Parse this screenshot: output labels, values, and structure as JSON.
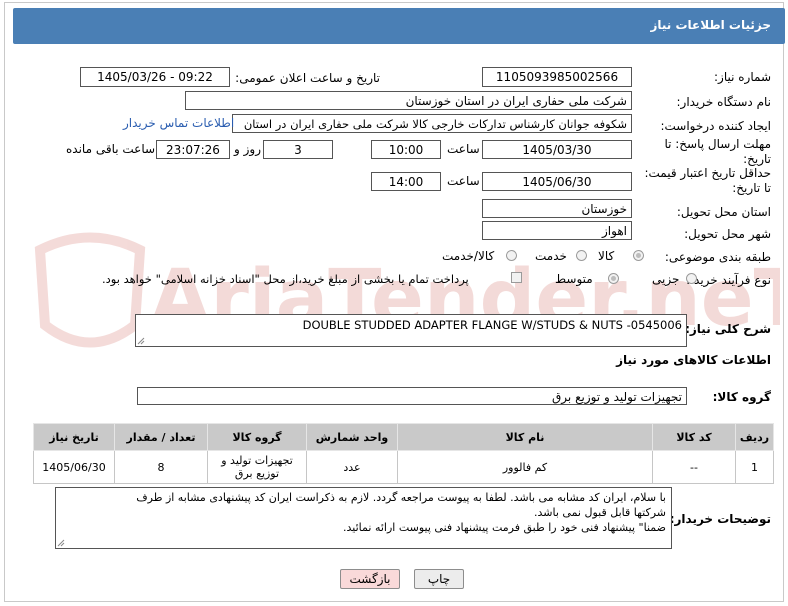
{
  "header": {
    "title": "جزئیات اطلاعات نیاز"
  },
  "fields": {
    "need_number_label": "شماره نیاز:",
    "need_number": "1105093985002566",
    "announce_label": "تاریخ و ساعت اعلان عمومی:",
    "announce_value": "1405/03/26 - 09:22",
    "buyer_org_label": "نام دستگاه خریدار:",
    "buyer_org": "شرکت ملی حفاری ایران در استان خوزستان",
    "requester_label": "ایجاد کننده درخواست:",
    "requester": "شکوفه جوانان کارشناس تدارکات خارجی کالا شرکت ملی حفاری ایران در استان",
    "buyer_contact_link": "اطلاعات تماس خریدار",
    "reply_deadline_label": "مهلت ارسال پاسخ: تا تاریخ:",
    "reply_date": "1405/03/30",
    "time_label": "ساعت",
    "reply_time": "10:00",
    "days_value": "3",
    "days_label": "روز و",
    "remaining_time": "23:07:26",
    "remaining_label": "ساعت باقی مانده",
    "price_validity_label": "حداقل تاریخ اعتبار قیمت: تا تاریخ:",
    "price_date": "1405/06/30",
    "price_time": "14:00",
    "province_label": "استان محل تحویل:",
    "province": "خوزستان",
    "city_label": "شهر محل تحویل:",
    "city": "اهواز",
    "category_label": "طبقه بندی موضوعی:",
    "category_options": [
      "کالا",
      "خدمت",
      "کالا/خدمت"
    ],
    "process_label": "نوع فرآیند خرید :",
    "process_options": [
      "جزیی",
      "متوسط"
    ],
    "payment_note": "پرداخت تمام یا بخشی از مبلغ خرید،از محل \"اسناد خزانه اسلامی\" خواهد بود.",
    "summary_label": "شرح کلی نیاز:",
    "summary": "DOUBLE STUDDED ADAPTER FLANGE  W/STUDS & NUTS -0545006",
    "items_section_label": "اطلاعات کالاهای مورد نیاز",
    "group_label": "گروه کالا:",
    "group_value": "تجهیزات تولید و توزیع برق"
  },
  "table": {
    "headers": [
      "ردیف",
      "کد کالا",
      "نام کالا",
      "واحد شمارش",
      "گروه کالا",
      "تعداد / مقدار",
      "تاریخ نیاز"
    ],
    "rows": [
      [
        "1",
        "--",
        "کم فالوور",
        "عدد",
        "تجهیزات تولید و توزیع برق",
        "8",
        "1405/06/30"
      ]
    ]
  },
  "buyer_notes": {
    "label": "توضیحات خریدار:",
    "lines": [
      "با سلام، ایران کد مشابه می باشد. لطفا به پیوست مراجعه گردد. لازم به ذکراست ایران کد پیشنهادی مشابه از طرف",
      "شرکتها قابل قبول نمی باشد.",
      "ضمنا\" پیشنهاد فنی خود را طبق فرمت پیشنهاد فنی پیوست ارائه نمائید."
    ]
  },
  "buttons": {
    "print": "چاپ",
    "back": "بازگشت"
  },
  "watermark": {
    "text": "AriaTender.neT"
  },
  "colors": {
    "header": "#4a7fb5",
    "link": "#2a5db0",
    "table_header": "#c9c9c9",
    "back_button": "#f9d9d9"
  }
}
